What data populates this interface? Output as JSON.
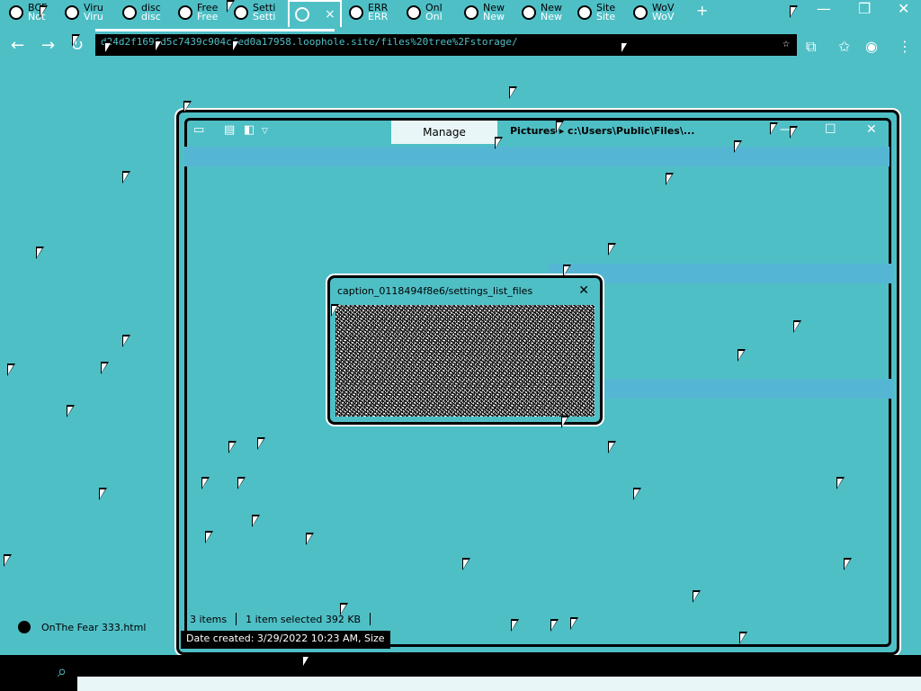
{
  "browser": {
    "tabs": [
      {
        "label": "BCF",
        "sub": "Not"
      },
      {
        "label": "Viru",
        "sub": "Viru"
      },
      {
        "label": "disc",
        "sub": "disc"
      },
      {
        "label": "Free",
        "sub": "Free"
      },
      {
        "label": "Setti",
        "sub": "Setti"
      },
      {
        "label": "ERR",
        "sub": "ERR"
      },
      {
        "label": "Onl",
        "sub": "Onl"
      },
      {
        "label": "New",
        "sub": "New"
      },
      {
        "label": "New",
        "sub": "New"
      },
      {
        "label": "Site",
        "sub": "Site"
      },
      {
        "label": "WoV",
        "sub": "WoV"
      }
    ],
    "active_tab_close": "×",
    "new_tab": "+",
    "address": "d24d2f1696d5c7439c904cfed0a17958.loophole.site/files%20tree%2Fstorage/",
    "nav_back": "←",
    "nav_forward": "→",
    "nav_reload": "↻",
    "icons": [
      "star-icon",
      "collections-icon",
      "profile-icon",
      "menu-icon"
    ],
    "window_controls": {
      "minimize": "—",
      "restore": "❐",
      "close": "✕"
    }
  },
  "explorer": {
    "manage_label": "Manage",
    "title": "Pictures ▸ c:\\Users\\Public\\Files\\...",
    "controls": {
      "minimize": "—",
      "maximize": "☐",
      "close": "✕"
    },
    "status_items": "3 items",
    "status_selected": "1 item selected  392 KB",
    "tooltip": "Date created: 3/29/2022 10:23 AM, Size"
  },
  "dialog": {
    "title": "caption_0118494f8e6/settings_list_files",
    "close": "✕"
  },
  "desktop": {
    "file_label": "OnThe Fear 333.html"
  },
  "taskbar": {
    "search_icon": "⌕",
    "tray_text": "",
    "corner_text": ""
  }
}
